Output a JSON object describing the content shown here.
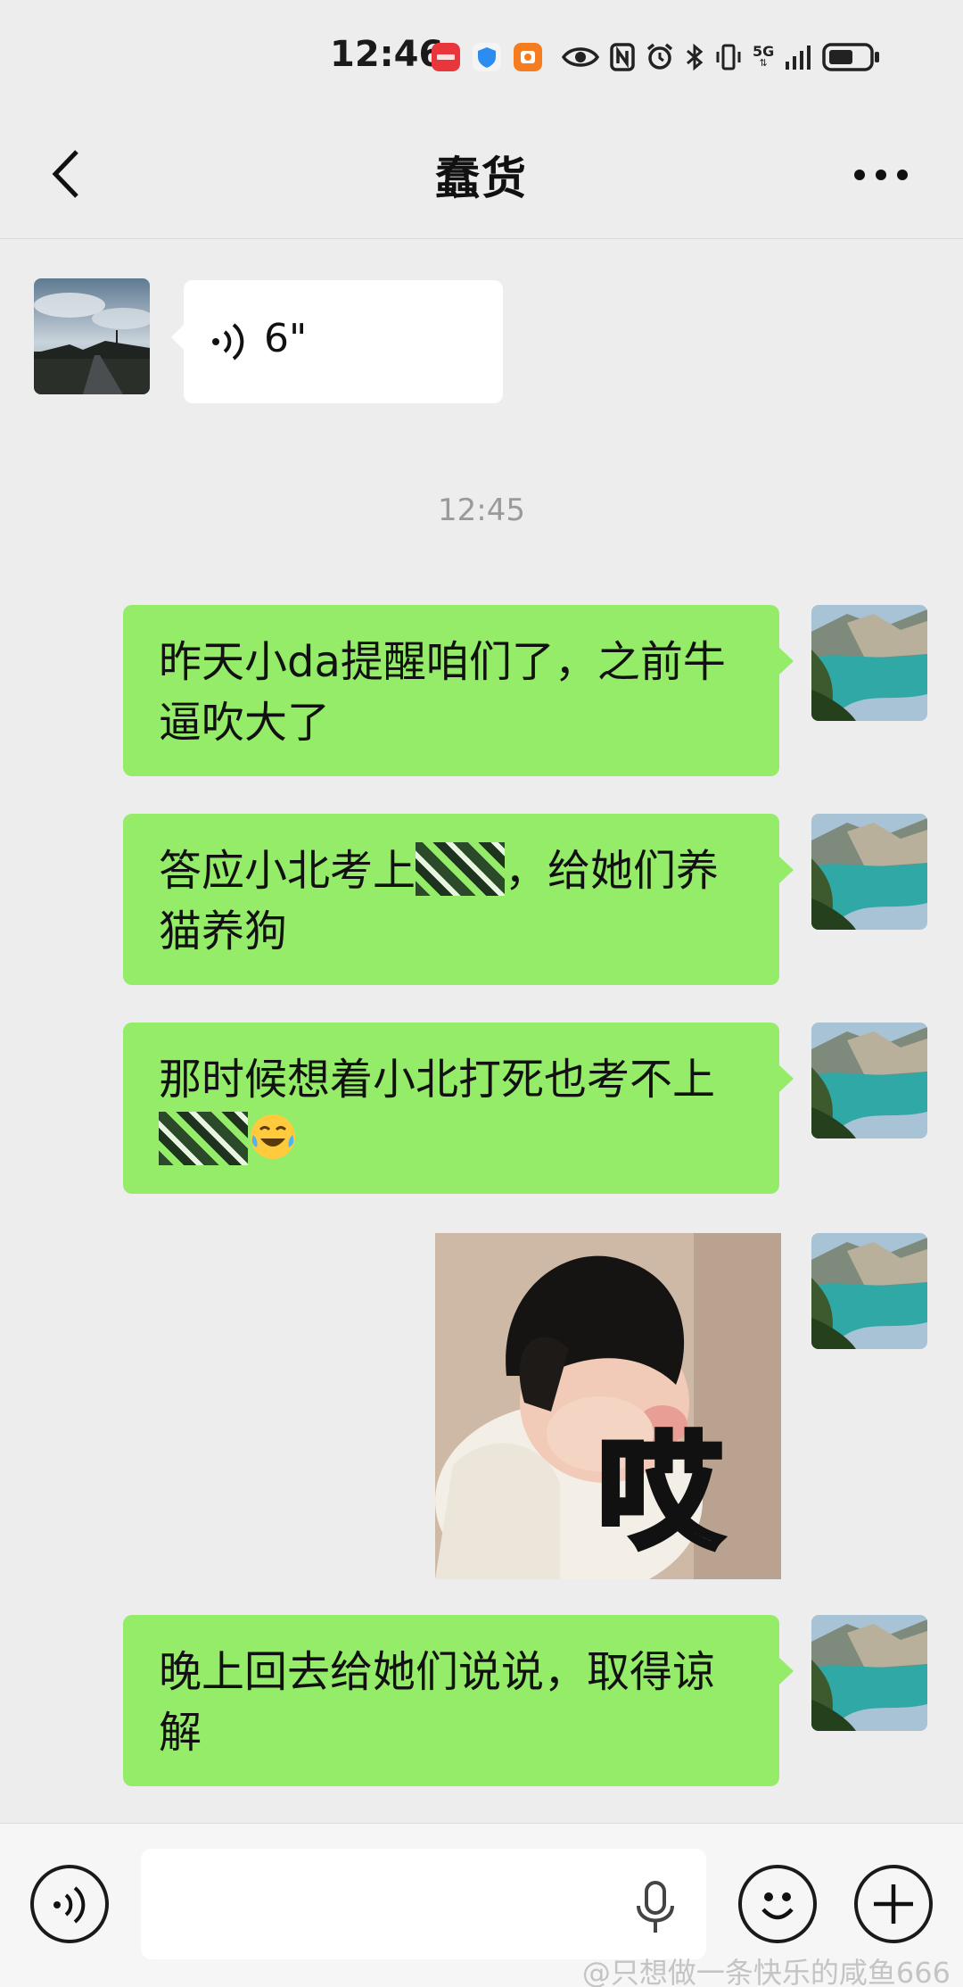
{
  "status_bar": {
    "time": "12:46",
    "network": "5G"
  },
  "header": {
    "title": "蠢货"
  },
  "voice_message": {
    "duration": "6\""
  },
  "timestamp": "12:45",
  "messages": [
    {
      "text": "昨天小da提醒咱们了，之前牛逼吹大了"
    },
    {
      "text_before": "答应小北考上",
      "text_after": "，给她们养猫养狗"
    },
    {
      "text_before": "那时候想着小北打死也考不上"
    },
    {
      "text": "晚上回去给她们说说，取得谅解"
    }
  ],
  "sticker": {
    "caption": "哎"
  },
  "watermark": "@只想做一条快乐的咸鱼666",
  "colors": {
    "background": "#ededed",
    "bubble_sent": "#95ec69",
    "bubble_received": "#ffffff"
  }
}
